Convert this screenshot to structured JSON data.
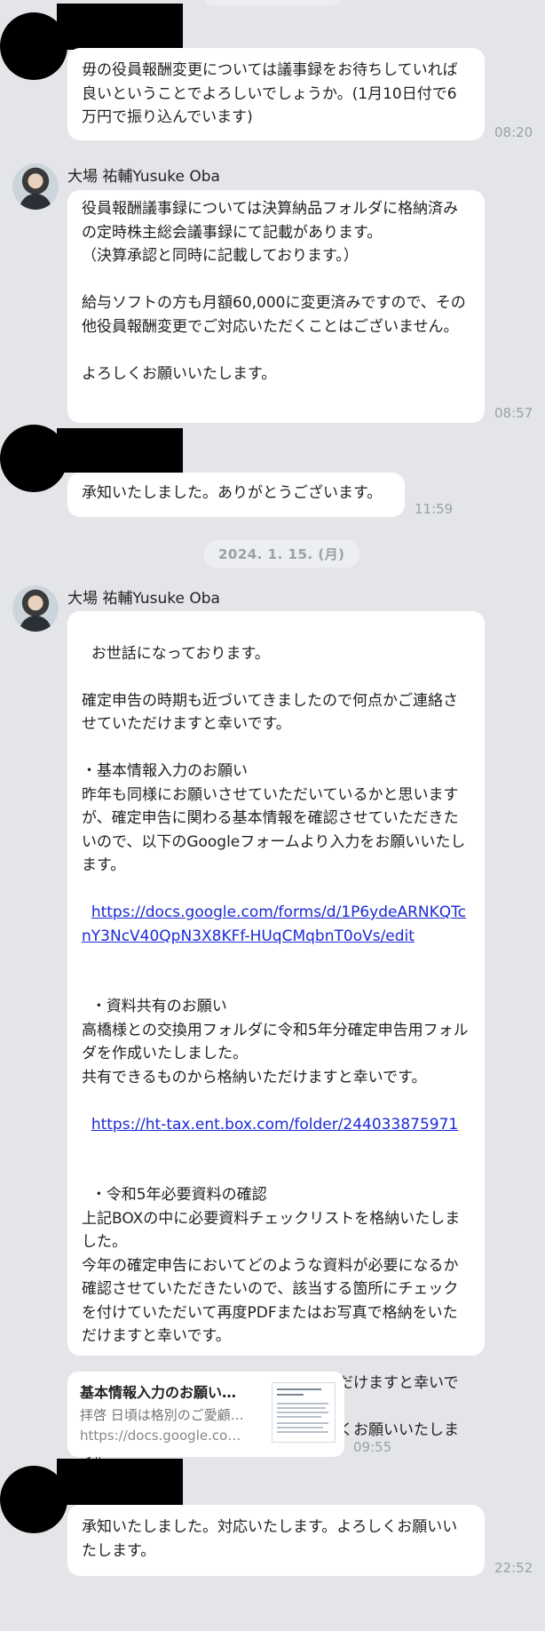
{
  "messages": {
    "m1": {
      "text": "毋の役員報酬変更については議事録をお待ちしていれば良いということでよろしいでしょうか。(1月10日付で6万円で振り込んでいます)",
      "time": "08:20"
    },
    "m2": {
      "sender": "大場 祐輔Yusuke Oba",
      "text": "役員報酬議事録については決算納品フォルダに格納済みの定時株主総会議事録にて記載があります。\n（決算承認と同時に記載しております。）\n\n給与ソフトの方も月額60,000に変更済みですので、その他役員報酬変更でご対応いただくことはございません。\n\nよろしくお願いいたします。",
      "time": "08:57"
    },
    "m3": {
      "text": "承知いたしました。ありがとうございます。",
      "time": "11:59"
    },
    "date_divider": "2024. 1. 15. (月)",
    "m4": {
      "sender": "大場 祐輔Yusuke Oba",
      "p1": "お世話になっております。\n\n確定申告の時期も近づいてきましたので何点かご連絡させていただけますと幸いです。\n\n・基本情報入力のお願い\n昨年も同様にお願いさせていただいているかと思いますが、確定申告に関わる基本情報を確認させていただきたいので、以下のGoogleフォームより入力をお願いいたします。",
      "link1": "https://docs.google.com/forms/d/1P6ydeARNKQTcnY3NcV40QpN3X8KFf-HUqCMqbnT0oVs/edit",
      "p2": "・資料共有のお願い\n高橋様との交換用フォルダに令和5年分確定申告用フォルダを作成いたしました。\n共有できるものから格納いただけますと幸いです。",
      "link2": "https://ht-tax.ent.box.com/folder/244033875971",
      "p3": "・令和5年必要資料の確認\n上記BOXの中に必要資料チェックリストを格納いたしました。\n今年の確定申告においてどのような資料が必要になるか確認させていただきたいので、該当する箇所にチェックを付けていただいて再度PDFまたはお写真で格納をいただけますと幸いです。\n\nご不明点等ございましたらご連絡いただけますと幸いです。\nお忙しい中大変恐縮ですが何卒よろしくお願いいたします。"
    },
    "link_card": {
      "title": "基本情報入力のお願い…",
      "desc": "拝啓 日頃は格別のご愛顧…",
      "url": "https://docs.google.co…",
      "time": "09:55"
    },
    "m5": {
      "text": "承知いたしました。対応いたします。よろしくお願いいたします。",
      "time": "22:52"
    }
  }
}
